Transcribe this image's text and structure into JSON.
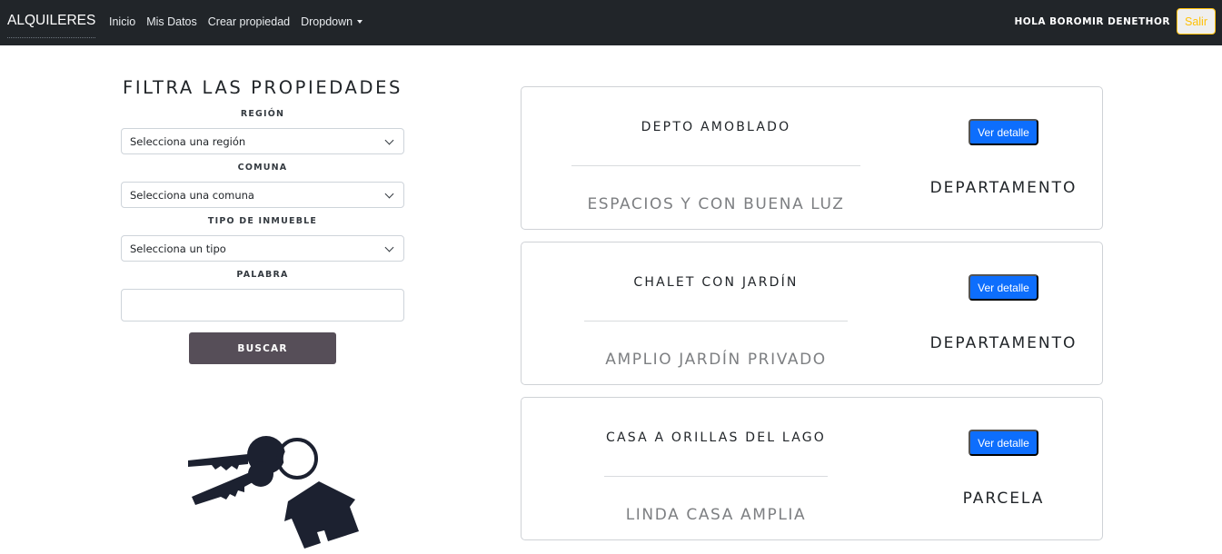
{
  "navbar": {
    "brand": "ALQUILERES",
    "links": [
      "Inicio",
      "Mis Datos",
      "Crear propiedad"
    ],
    "dropdown_label": "Dropdown",
    "greeting": "HOLA BOROMIR DENETHOR",
    "logout_label": "Salir"
  },
  "filter": {
    "title": "FILTRA LAS PROPIEDADES",
    "region_label": "REGIÓN",
    "region_value": "Selecciona una región",
    "comuna_label": "COMUNA",
    "comuna_value": "Selecciona una comuna",
    "tipo_label": "TIPO DE INMUEBLE",
    "tipo_value": "Selecciona un tipo",
    "palabra_label": "PALABRA",
    "palabra_value": "",
    "search_label": "BUSCAR"
  },
  "properties": [
    {
      "title": "DEPTO AMOBLADO",
      "description": "ESPACIOS Y CON BUENA LUZ",
      "type": "DEPARTAMENTO",
      "button_label": "Ver detalle"
    },
    {
      "title": "CHALET CON JARDÍN",
      "description": "AMPLIO JARDÍN PRIVADO",
      "type": "DEPARTAMENTO",
      "button_label": "Ver detalle"
    },
    {
      "title": "CASA A ORILLAS DEL LAGO",
      "description": "LINDA CASA AMPLIA",
      "type": "PARCELA",
      "button_label": "Ver detalle"
    }
  ],
  "colors": {
    "navbar_bg": "#212529",
    "accent_blue": "#0d6efd",
    "logout_yellow": "#ffc107",
    "search_button": "#564e58"
  },
  "icons": {
    "illustration": "house-keys-icon",
    "select_chevron": "chevron-down-icon"
  }
}
